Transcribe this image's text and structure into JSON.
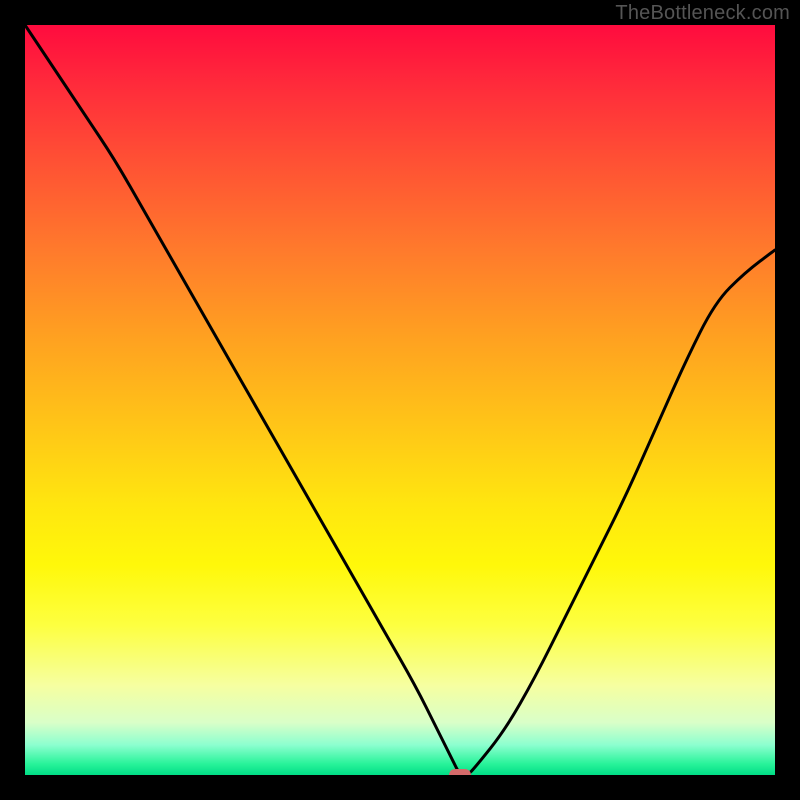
{
  "watermark": "TheBottleneck.com",
  "colors": {
    "frame": "#000000",
    "curve": "#000000",
    "marker": "#d46a6a",
    "watermark_text": "#555555"
  },
  "chart_data": {
    "type": "line",
    "title": "",
    "xlabel": "",
    "ylabel": "",
    "xlim": [
      0,
      100
    ],
    "ylim": [
      0,
      100
    ],
    "grid": false,
    "legend": false,
    "annotations": [],
    "series": [
      {
        "name": "bottleneck-curve",
        "x": [
          0,
          4,
          8,
          12,
          16,
          20,
          24,
          28,
          32,
          36,
          40,
          44,
          48,
          52,
          55,
          57,
          58,
          59,
          60,
          64,
          68,
          72,
          76,
          80,
          84,
          88,
          92,
          96,
          100
        ],
        "values": [
          100,
          94,
          88,
          82,
          75,
          68,
          61,
          54,
          47,
          40,
          33,
          26,
          19,
          12,
          6,
          2,
          0,
          0,
          1,
          6,
          13,
          21,
          29,
          37,
          46,
          55,
          63,
          67,
          70
        ]
      }
    ],
    "marker": {
      "x": 58,
      "y": 0,
      "width_pct": 3.0,
      "height_pct": 1.6
    },
    "background_gradient_meaning": "vertical gradient indicates bottleneck severity: red (top, high) to green (bottom, low)"
  }
}
